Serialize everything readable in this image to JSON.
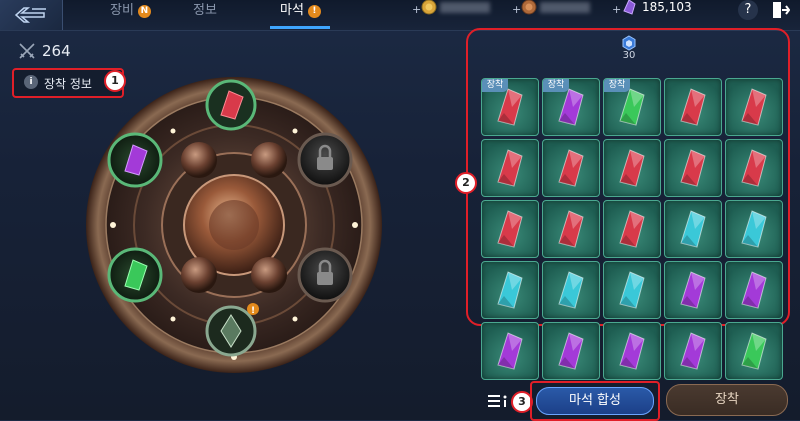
{
  "top_bar": {
    "tabs": [
      {
        "label": "장비",
        "badge": "N"
      },
      {
        "label": "정보",
        "badge": ""
      },
      {
        "label": "마석",
        "badge": "!"
      }
    ],
    "active_tab": "마석",
    "currency": [
      {
        "icon": "gold-coin-icon",
        "value": ""
      },
      {
        "icon": "copper-coin-icon",
        "value": ""
      },
      {
        "icon": "purple-crystal-icon",
        "value": "185,103"
      }
    ],
    "help_label": "?"
  },
  "left": {
    "power_value": "264",
    "equip_info_label": "장착 정보",
    "marker_1": "1",
    "marker_3": "3"
  },
  "gem_panel": {
    "capacity": "30",
    "marker_2": "2",
    "equip_tag_label": "장착",
    "colors": {
      "red": "#d83a4a",
      "purple": "#a33ad8",
      "green": "#3ac85a",
      "cyan": "#3ac8d8"
    },
    "slots": [
      {
        "color": "red",
        "equipped": true
      },
      {
        "color": "purple",
        "equipped": true
      },
      {
        "color": "green",
        "equipped": true
      },
      {
        "color": "red",
        "equipped": false
      },
      {
        "color": "red",
        "equipped": false
      },
      {
        "color": "red",
        "equipped": false
      },
      {
        "color": "red",
        "equipped": false
      },
      {
        "color": "red",
        "equipped": false
      },
      {
        "color": "red",
        "equipped": false
      },
      {
        "color": "red",
        "equipped": false
      },
      {
        "color": "red",
        "equipped": false
      },
      {
        "color": "red",
        "equipped": false
      },
      {
        "color": "red",
        "equipped": false
      },
      {
        "color": "cyan",
        "equipped": false
      },
      {
        "color": "cyan",
        "equipped": false
      },
      {
        "color": "cyan",
        "equipped": false
      },
      {
        "color": "cyan",
        "equipped": false
      },
      {
        "color": "cyan",
        "equipped": false
      },
      {
        "color": "purple",
        "equipped": false
      },
      {
        "color": "purple",
        "equipped": false
      },
      {
        "color": "purple",
        "equipped": false
      },
      {
        "color": "purple",
        "equipped": false
      },
      {
        "color": "purple",
        "equipped": false
      },
      {
        "color": "purple",
        "equipped": false
      },
      {
        "color": "green",
        "equipped": false
      }
    ]
  },
  "bottom": {
    "synth_label": "마석 합성",
    "equip_label": "장착"
  }
}
